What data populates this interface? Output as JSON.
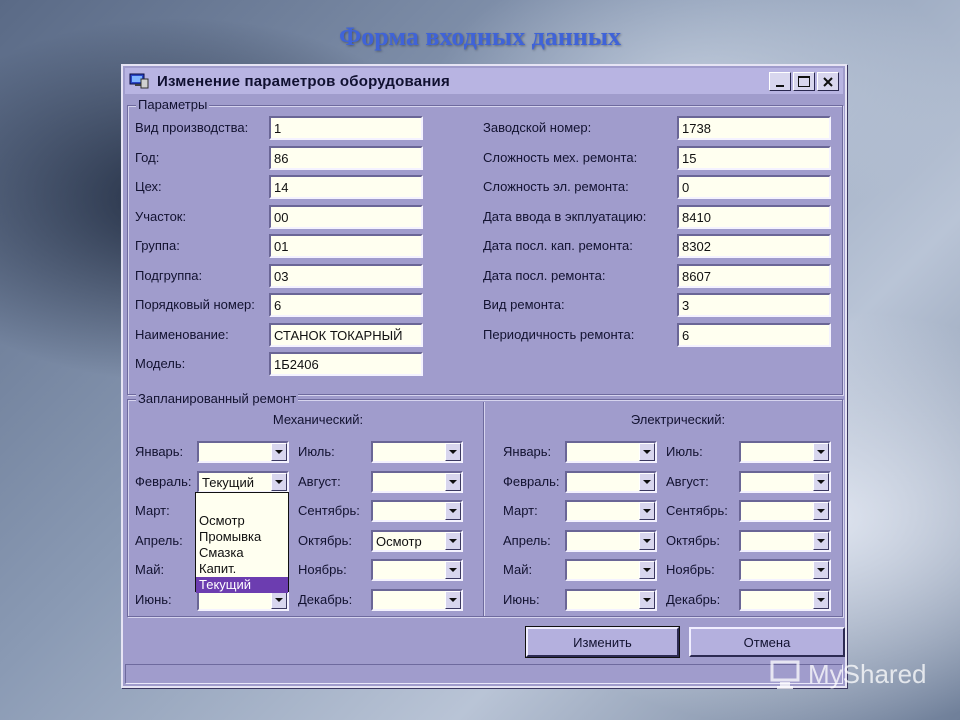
{
  "slide": {
    "title": "Форма входных данных"
  },
  "window": {
    "title": "Изменение параметров оборудования"
  },
  "params": {
    "legend": "Параметры",
    "left": [
      {
        "label": "Вид производства:",
        "value": "1"
      },
      {
        "label": "Год:",
        "value": "86"
      },
      {
        "label": "Цех:",
        "value": "14"
      },
      {
        "label": "Участок:",
        "value": "00"
      },
      {
        "label": "Группа:",
        "value": "01"
      },
      {
        "label": "Подгруппа:",
        "value": "03"
      },
      {
        "label": "Порядковый номер:",
        "value": "6"
      },
      {
        "label": "Наименование:",
        "value": "СТАНОК ТОКАРНЫЙ"
      },
      {
        "label": "Модель:",
        "value": "1Б2406"
      }
    ],
    "right": [
      {
        "label": "Заводской номер:",
        "value": "1738"
      },
      {
        "label": "Сложность мех. ремонта:",
        "value": "15"
      },
      {
        "label": "Сложность эл. ремонта:",
        "value": "0"
      },
      {
        "label": "Дата ввода в экплуатацию:",
        "value": "8410"
      },
      {
        "label": "Дата посл. кап. ремонта:",
        "value": "8302"
      },
      {
        "label": "Дата посл. ремонта:",
        "value": "8607"
      },
      {
        "label": "Вид ремонта:",
        "value": "3"
      },
      {
        "label": "Периодичность ремонта:",
        "value": "6"
      }
    ]
  },
  "repair": {
    "legend": "Запланированный ремонт",
    "mech_heading": "Механический:",
    "elec_heading": "Электрический:",
    "months_left": [
      "Январь:",
      "Февраль:",
      "Март:",
      "Апрель:",
      "Май:",
      "Июнь:"
    ],
    "months_right": [
      "Июль:",
      "Август:",
      "Сентябрь:",
      "Октябрь:",
      "Ноябрь:",
      "Декабрь:"
    ],
    "mech_left_values": [
      "",
      "Текущий",
      "",
      "",
      "",
      ""
    ],
    "mech_right_values": [
      "",
      "",
      "",
      "Осмотр",
      "",
      ""
    ],
    "elec_left_values": [
      "",
      "",
      "",
      "",
      "",
      ""
    ],
    "elec_right_values": [
      "",
      "",
      "",
      "",
      "",
      ""
    ],
    "dropdown_options": [
      "Осмотр",
      "Промывка",
      "Смазка",
      "Капит.",
      "Текущий"
    ],
    "dropdown_selected": "Текущий"
  },
  "buttons": {
    "save": "Изменить",
    "cancel": "Отмена"
  },
  "watermark": "MyShared",
  "colors": {
    "window_bg": "#a09ccc",
    "titlebar_bg": "#b8b4e2",
    "selection": "#6c3db0",
    "slide_title": "#3f63d8"
  }
}
